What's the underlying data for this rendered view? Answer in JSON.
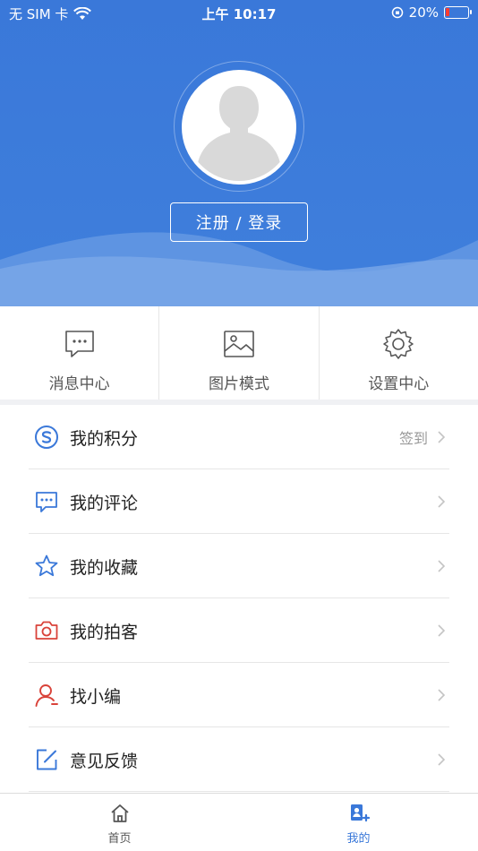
{
  "status_bar": {
    "carrier": "无 SIM 卡",
    "time": "上午 10:17",
    "battery_percent": "20%"
  },
  "profile": {
    "login_label": "注册 / 登录"
  },
  "quick_actions": [
    {
      "label": "消息中心",
      "icon": "chat-bubble-icon"
    },
    {
      "label": "图片模式",
      "icon": "image-icon"
    },
    {
      "label": "设置中心",
      "icon": "gear-icon"
    }
  ],
  "menu": [
    {
      "label": "我的积分",
      "hint": "签到",
      "icon": "points-s-icon",
      "color": "#3a78d9"
    },
    {
      "label": "我的评论",
      "hint": "",
      "icon": "comment-icon",
      "color": "#3a78d9"
    },
    {
      "label": "我的收藏",
      "hint": "",
      "icon": "star-icon",
      "color": "#3a78d9"
    },
    {
      "label": "我的拍客",
      "hint": "",
      "icon": "camera-icon",
      "color": "#d9433a"
    },
    {
      "label": "找小编",
      "hint": "",
      "icon": "person-icon",
      "color": "#d9433a"
    },
    {
      "label": "意见反馈",
      "hint": "",
      "icon": "edit-icon",
      "color": "#3a78d9"
    }
  ],
  "tabbar": [
    {
      "label": "首页",
      "icon": "home-icon",
      "active": false
    },
    {
      "label": "我的",
      "icon": "profile-badge-icon",
      "active": true
    }
  ],
  "colors": {
    "brand": "#3a78d9",
    "accent_red": "#d9433a",
    "tab_inactive": "#555555",
    "tab_active": "#3a78d9"
  }
}
